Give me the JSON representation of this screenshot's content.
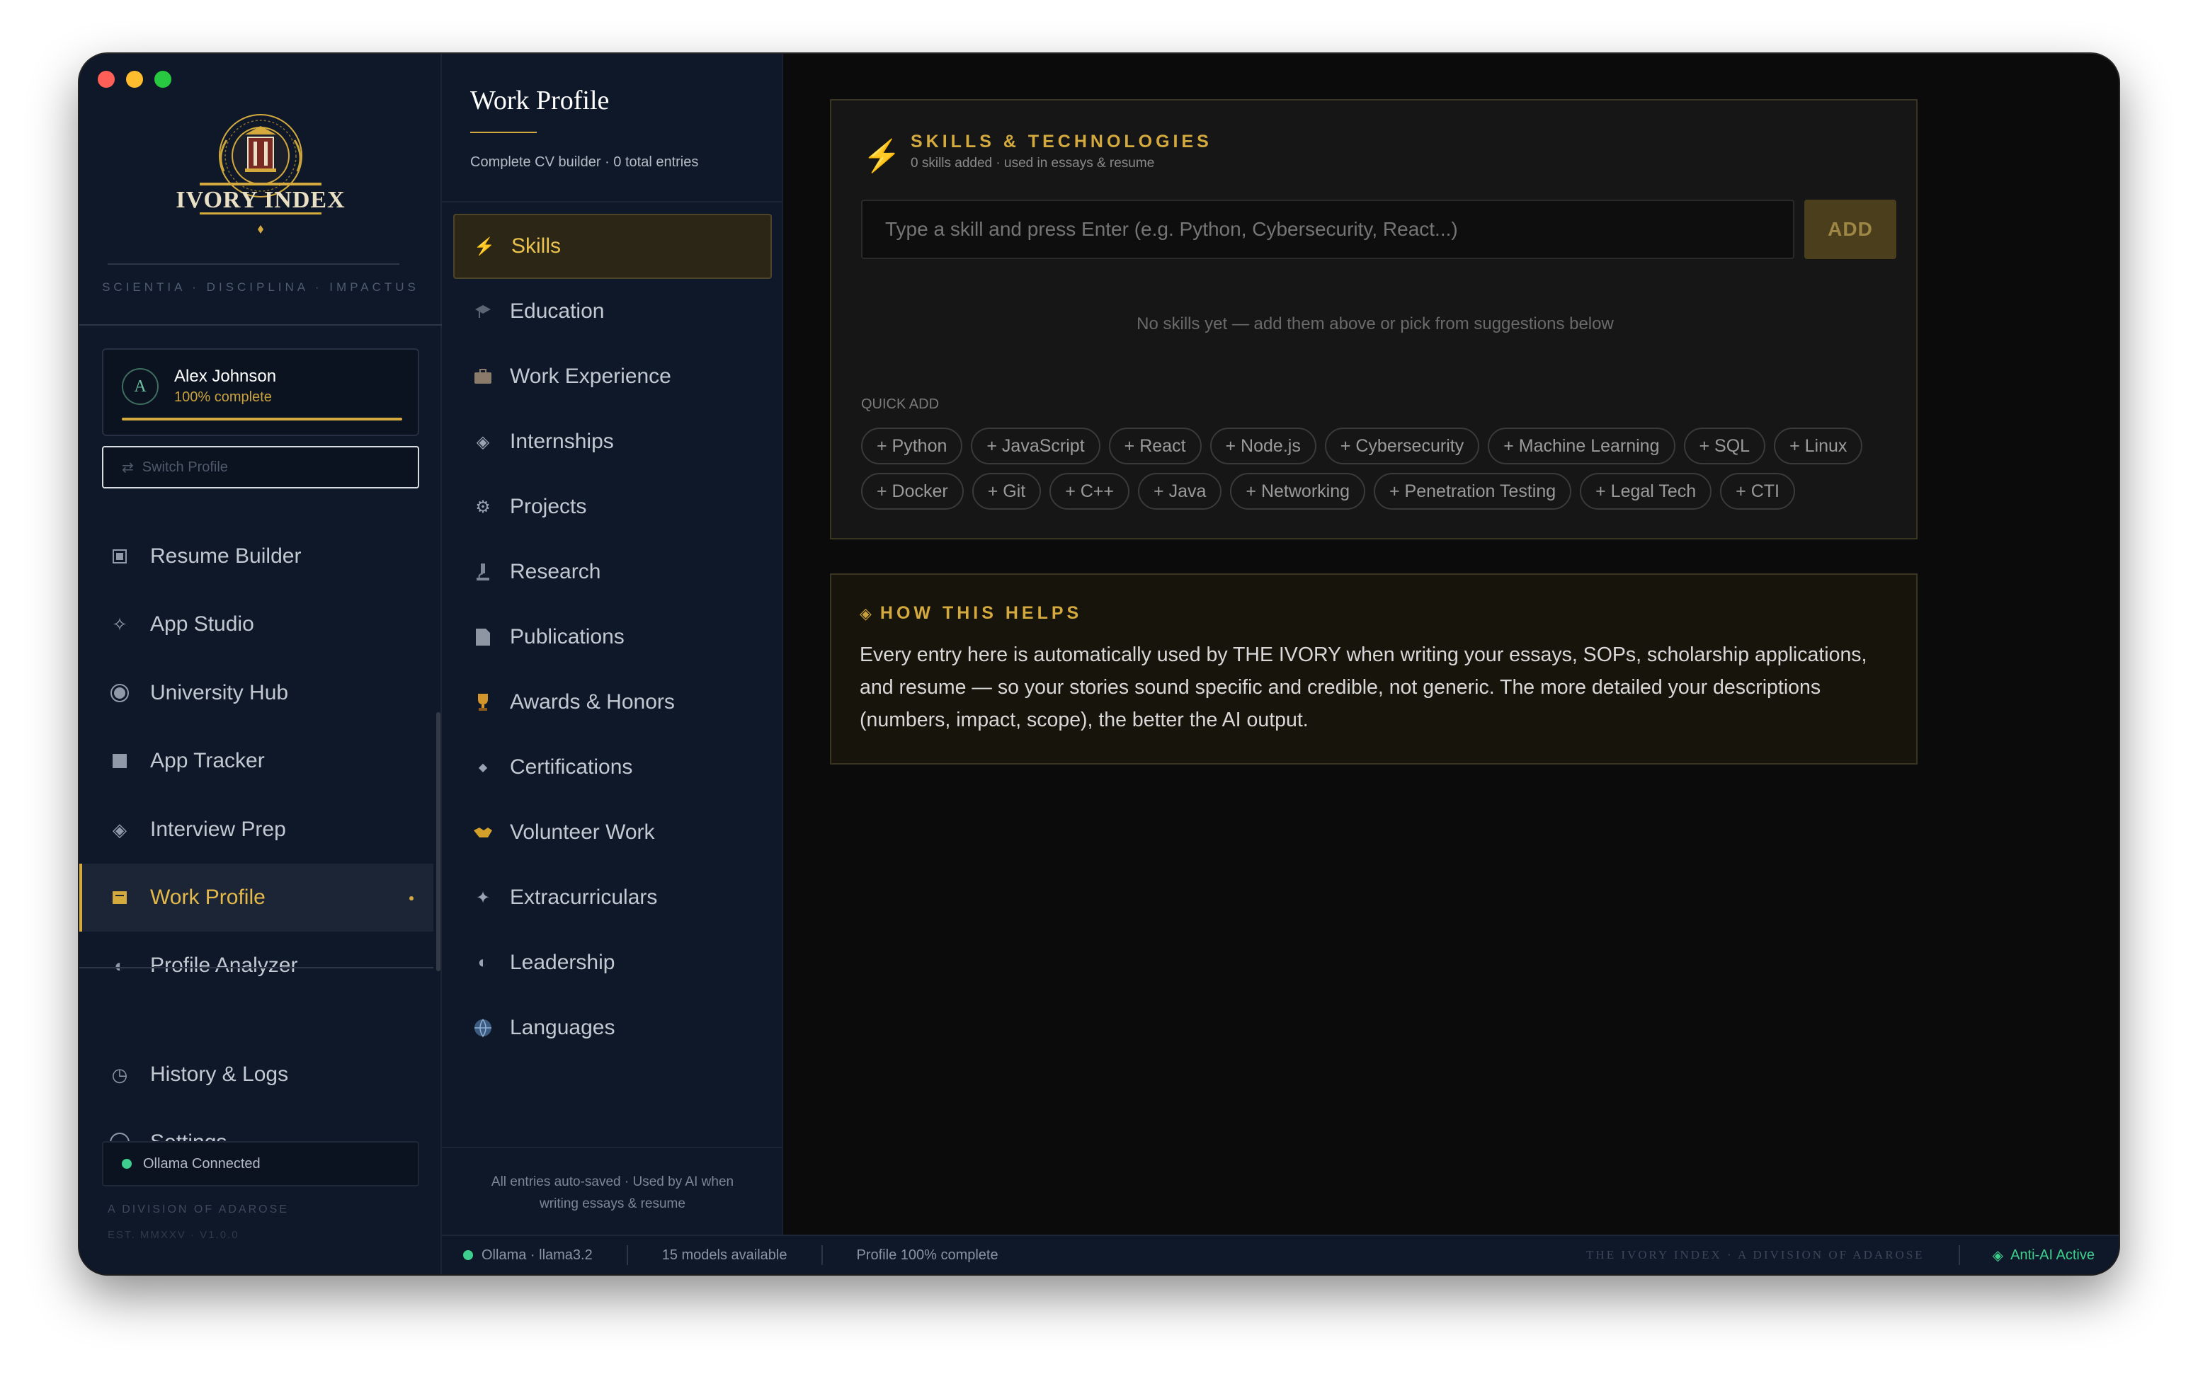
{
  "app": {
    "logo_text": "IVORY INDEX",
    "motto": "SCIENTIA · DISCIPLINA · IMPACTUS",
    "division": "A DIVISION OF ADAROSE",
    "version": "EST. MMXXV · V1.0.0"
  },
  "profile": {
    "initial": "A",
    "name": "Alex Johnson",
    "status": "100% complete",
    "progress_fraction": 1.0,
    "switch_label": "Switch Profile"
  },
  "sidebar": {
    "items": [
      {
        "label": "Resume Builder",
        "icon": "document-icon"
      },
      {
        "label": "App Studio",
        "icon": "sparkle-icon"
      },
      {
        "label": "University Hub",
        "icon": "globe-icon"
      },
      {
        "label": "App Tracker",
        "icon": "square-icon"
      },
      {
        "label": "Interview Prep",
        "icon": "diamond-icon"
      },
      {
        "label": "Work Profile",
        "icon": "briefcase-icon",
        "active": true
      },
      {
        "label": "Profile Analyzer",
        "icon": "half-circle-icon"
      }
    ],
    "footer_items": [
      {
        "label": "History & Logs",
        "icon": "clock-icon"
      },
      {
        "label": "Settings",
        "icon": "gear-icon"
      }
    ],
    "ollama_status": "Ollama Connected"
  },
  "work_profile": {
    "title": "Work Profile",
    "subtitle": "Complete CV builder · 0 total entries",
    "sections": [
      {
        "label": "Skills",
        "icon": "lightning-icon",
        "active": true
      },
      {
        "label": "Education",
        "icon": "graduation-cap-icon"
      },
      {
        "label": "Work Experience",
        "icon": "briefcase-icon"
      },
      {
        "label": "Internships",
        "icon": "diamond-icon"
      },
      {
        "label": "Projects",
        "icon": "gear-icon"
      },
      {
        "label": "Research",
        "icon": "microscope-icon"
      },
      {
        "label": "Publications",
        "icon": "page-icon"
      },
      {
        "label": "Awards & Honors",
        "icon": "trophy-icon"
      },
      {
        "label": "Certifications",
        "icon": "small-diamond-icon"
      },
      {
        "label": "Volunteer Work",
        "icon": "handshake-icon"
      },
      {
        "label": "Extracurriculars",
        "icon": "star-icon"
      },
      {
        "label": "Leadership",
        "icon": "half-circle-icon"
      },
      {
        "label": "Languages",
        "icon": "globe-icon"
      }
    ],
    "footer": "All entries auto-saved · Used by AI when writing essays & resume"
  },
  "skills": {
    "title": "SKILLS & TECHNOLOGIES",
    "subtitle": "0 skills added · used in essays & resume",
    "input_placeholder": "Type a skill and press Enter (e.g. Python, Cybersecurity, React...)",
    "add_label": "ADD",
    "empty_message": "No skills yet — add them above or pick from suggestions below",
    "quick_add_label": "QUICK ADD",
    "quick_add_row1": [
      "+ Python",
      "+ JavaScript",
      "+ React",
      "+ Node.js",
      "+ Cybersecurity",
      "+ Machine Learning",
      "+ SQL",
      "+ Linux"
    ],
    "quick_add_row2": [
      "+ Docker",
      "+ Git",
      "+ C++",
      "+ Java",
      "+ Networking",
      "+ Penetration Testing",
      "+ Legal Tech",
      "+ CTI"
    ]
  },
  "how_helps": {
    "title": "HOW THIS HELPS",
    "body": "Every entry here is automatically used by THE IVORY when writing your essays, SOPs, scholarship applications, and resume — so your stories sound specific and credible, not generic. The more detailed your descriptions (numbers, impact, scope), the better the AI output."
  },
  "statusbar": {
    "model": "Ollama · llama3.2",
    "models_available": "15 models available",
    "profile_complete": "Profile 100% complete",
    "brand": "THE IVORY INDEX · A DIVISION OF ADAROSE",
    "anti_ai": "Anti-AI Active"
  },
  "colors": {
    "accent_gold": "#d4aa3e",
    "sidebar_bg": "#0f1828",
    "main_bg": "#0b0b0b",
    "status_green": "#3ecf8e"
  }
}
